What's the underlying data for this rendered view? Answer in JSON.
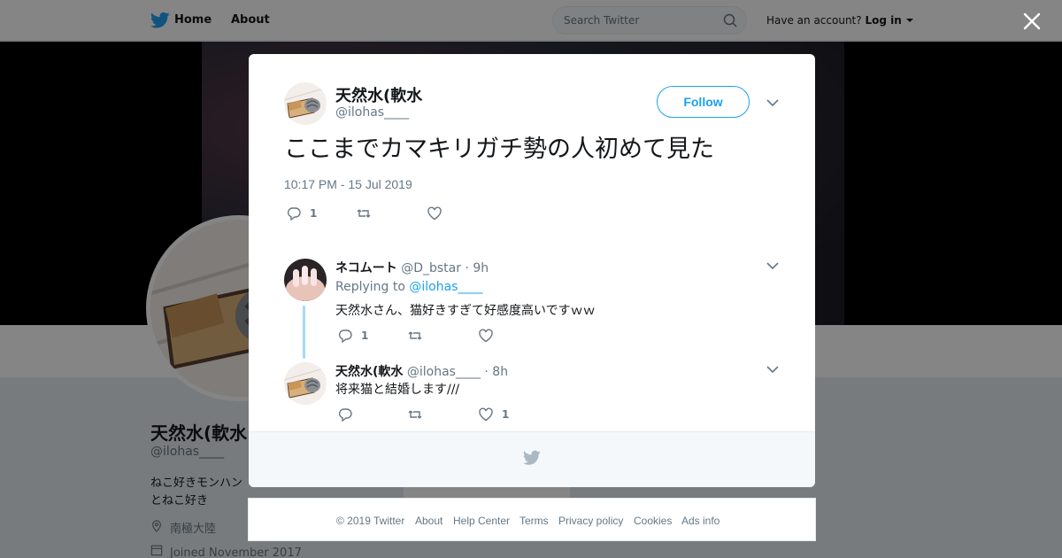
{
  "nav": {
    "home": "Home",
    "about": "About",
    "search_placeholder": "Search Twitter",
    "have_account": "Have an account?",
    "login": "Log in"
  },
  "profile": {
    "name": "天然水(軟水",
    "handle": "@ilohas____",
    "bio_line1": "ねこ好きモンハン",
    "bio_line2": "とねこ好き",
    "location": "南極大陸",
    "joined": "Joined November 2017"
  },
  "tweet": {
    "name": "天然水(軟水",
    "handle": "@ilohas____",
    "follow_label": "Follow",
    "text": "ここまでカマキリガチ勢の人初めて見た",
    "timestamp": "10:17 PM - 15 Jul 2019",
    "reply_count": "1"
  },
  "replies": [
    {
      "name": "ネコムート",
      "handle": "@D_bstar",
      "age": "· 9h",
      "replying_prefix": "Replying to",
      "replying_to": "@ilohas____",
      "text": "天然水さん、猫好きすぎて好感度高いですｗｗ",
      "reply_count": "1"
    },
    {
      "name": "天然水(軟水",
      "handle": "@ilohas____",
      "age": "· 8h",
      "text": "将来猫と結婚します///",
      "like_count": "1"
    }
  ],
  "footer": {
    "copyright": "© 2019 Twitter",
    "about": "About",
    "help": "Help Center",
    "terms": "Terms",
    "privacy": "Privacy policy",
    "cookies": "Cookies",
    "ads": "Ads info"
  },
  "colors": {
    "brand_blue": "#1da1f2",
    "thread_line": "#a3d9f9",
    "text_primary": "#14171a",
    "text_secondary": "#657786"
  }
}
